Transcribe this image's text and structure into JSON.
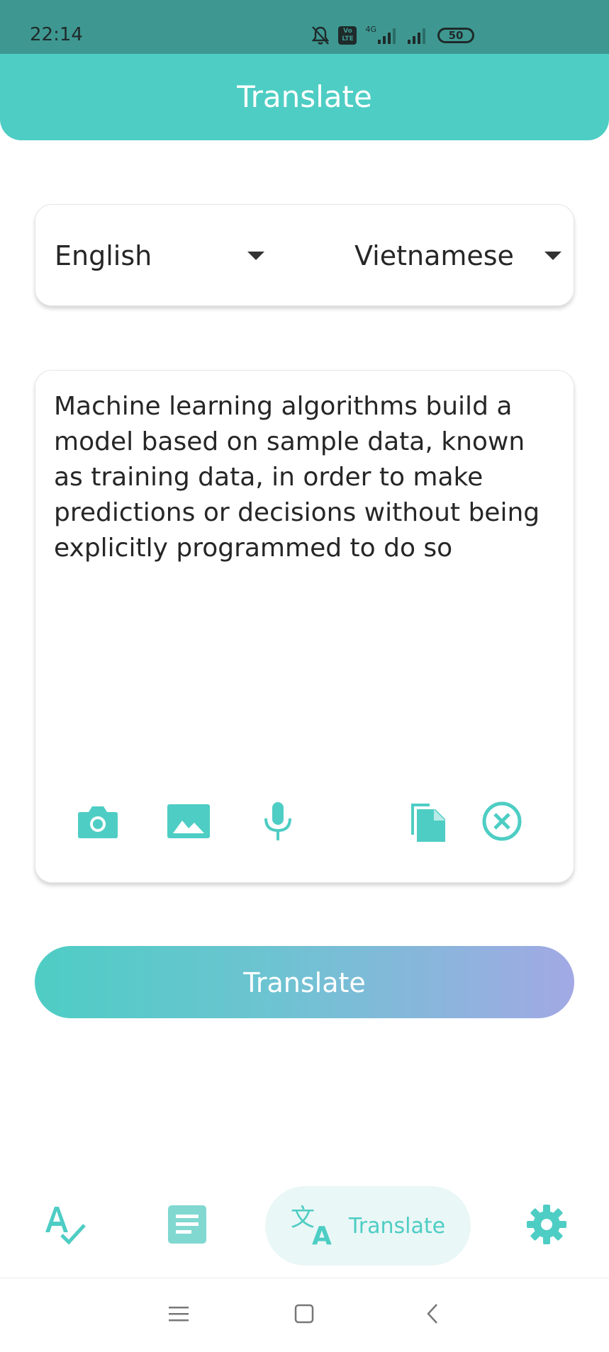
{
  "status_bar": {
    "time": "22:14",
    "volte_badge": "Vo LTE",
    "network": "4G",
    "battery": "50",
    "icons": [
      "bell-off-icon",
      "volte-icon",
      "signal-icon",
      "signal-icon",
      "battery-icon"
    ]
  },
  "header": {
    "title": "Translate"
  },
  "languages": {
    "source": "English",
    "target": "Vietnamese"
  },
  "input": {
    "text": "Machine learning algorithms build a model based on sample data, known as training data, in order to make predictions or decisions without being explicitly programmed to do so"
  },
  "tools": [
    "camera-icon",
    "image-icon",
    "mic-icon",
    "paste-icon",
    "clear-icon"
  ],
  "translate_button": {
    "label": "Translate"
  },
  "bottom_nav": {
    "items": [
      {
        "icon": "spellcheck-icon"
      },
      {
        "icon": "notes-icon"
      },
      {
        "icon": "translate-icon",
        "label": "Translate",
        "active": true
      },
      {
        "icon": "settings-icon"
      }
    ]
  },
  "colors": {
    "accent": "#4ecdc4",
    "status_bar": "#3e9891",
    "gradient_end": "#a2a9e4",
    "active_pill": "#e9f7f6"
  }
}
